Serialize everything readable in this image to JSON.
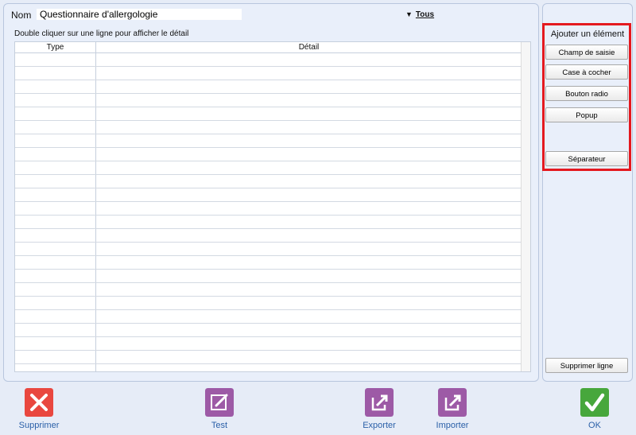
{
  "form": {
    "name_label": "Nom",
    "name_value": "Questionnaire d'allergologie",
    "filter_label": "Tous",
    "hint": "Double cliquer sur une ligne pour afficher le détail"
  },
  "table": {
    "columns": [
      "Type",
      "Détail"
    ]
  },
  "sidebar": {
    "title": "Ajouter un élément",
    "buttons": [
      "Champ de saisie",
      "Case à cocher",
      "Bouton radio",
      "Popup",
      "Séparateur"
    ],
    "delete_line": "Supprimer ligne"
  },
  "toolbar": {
    "delete": "Supprimer",
    "test": "Test",
    "export": "Exporter",
    "import": "Importer",
    "ok": "OK"
  },
  "colors": {
    "delete_icon": "#e9473f",
    "purple_icon": "#9d5aa6",
    "ok_icon": "#47a73c",
    "highlight": "#e4191f"
  },
  "icons": {
    "delete": "close-icon",
    "test": "edit-icon",
    "export": "export-icon",
    "import": "import-icon",
    "ok": "checkmark-icon"
  }
}
